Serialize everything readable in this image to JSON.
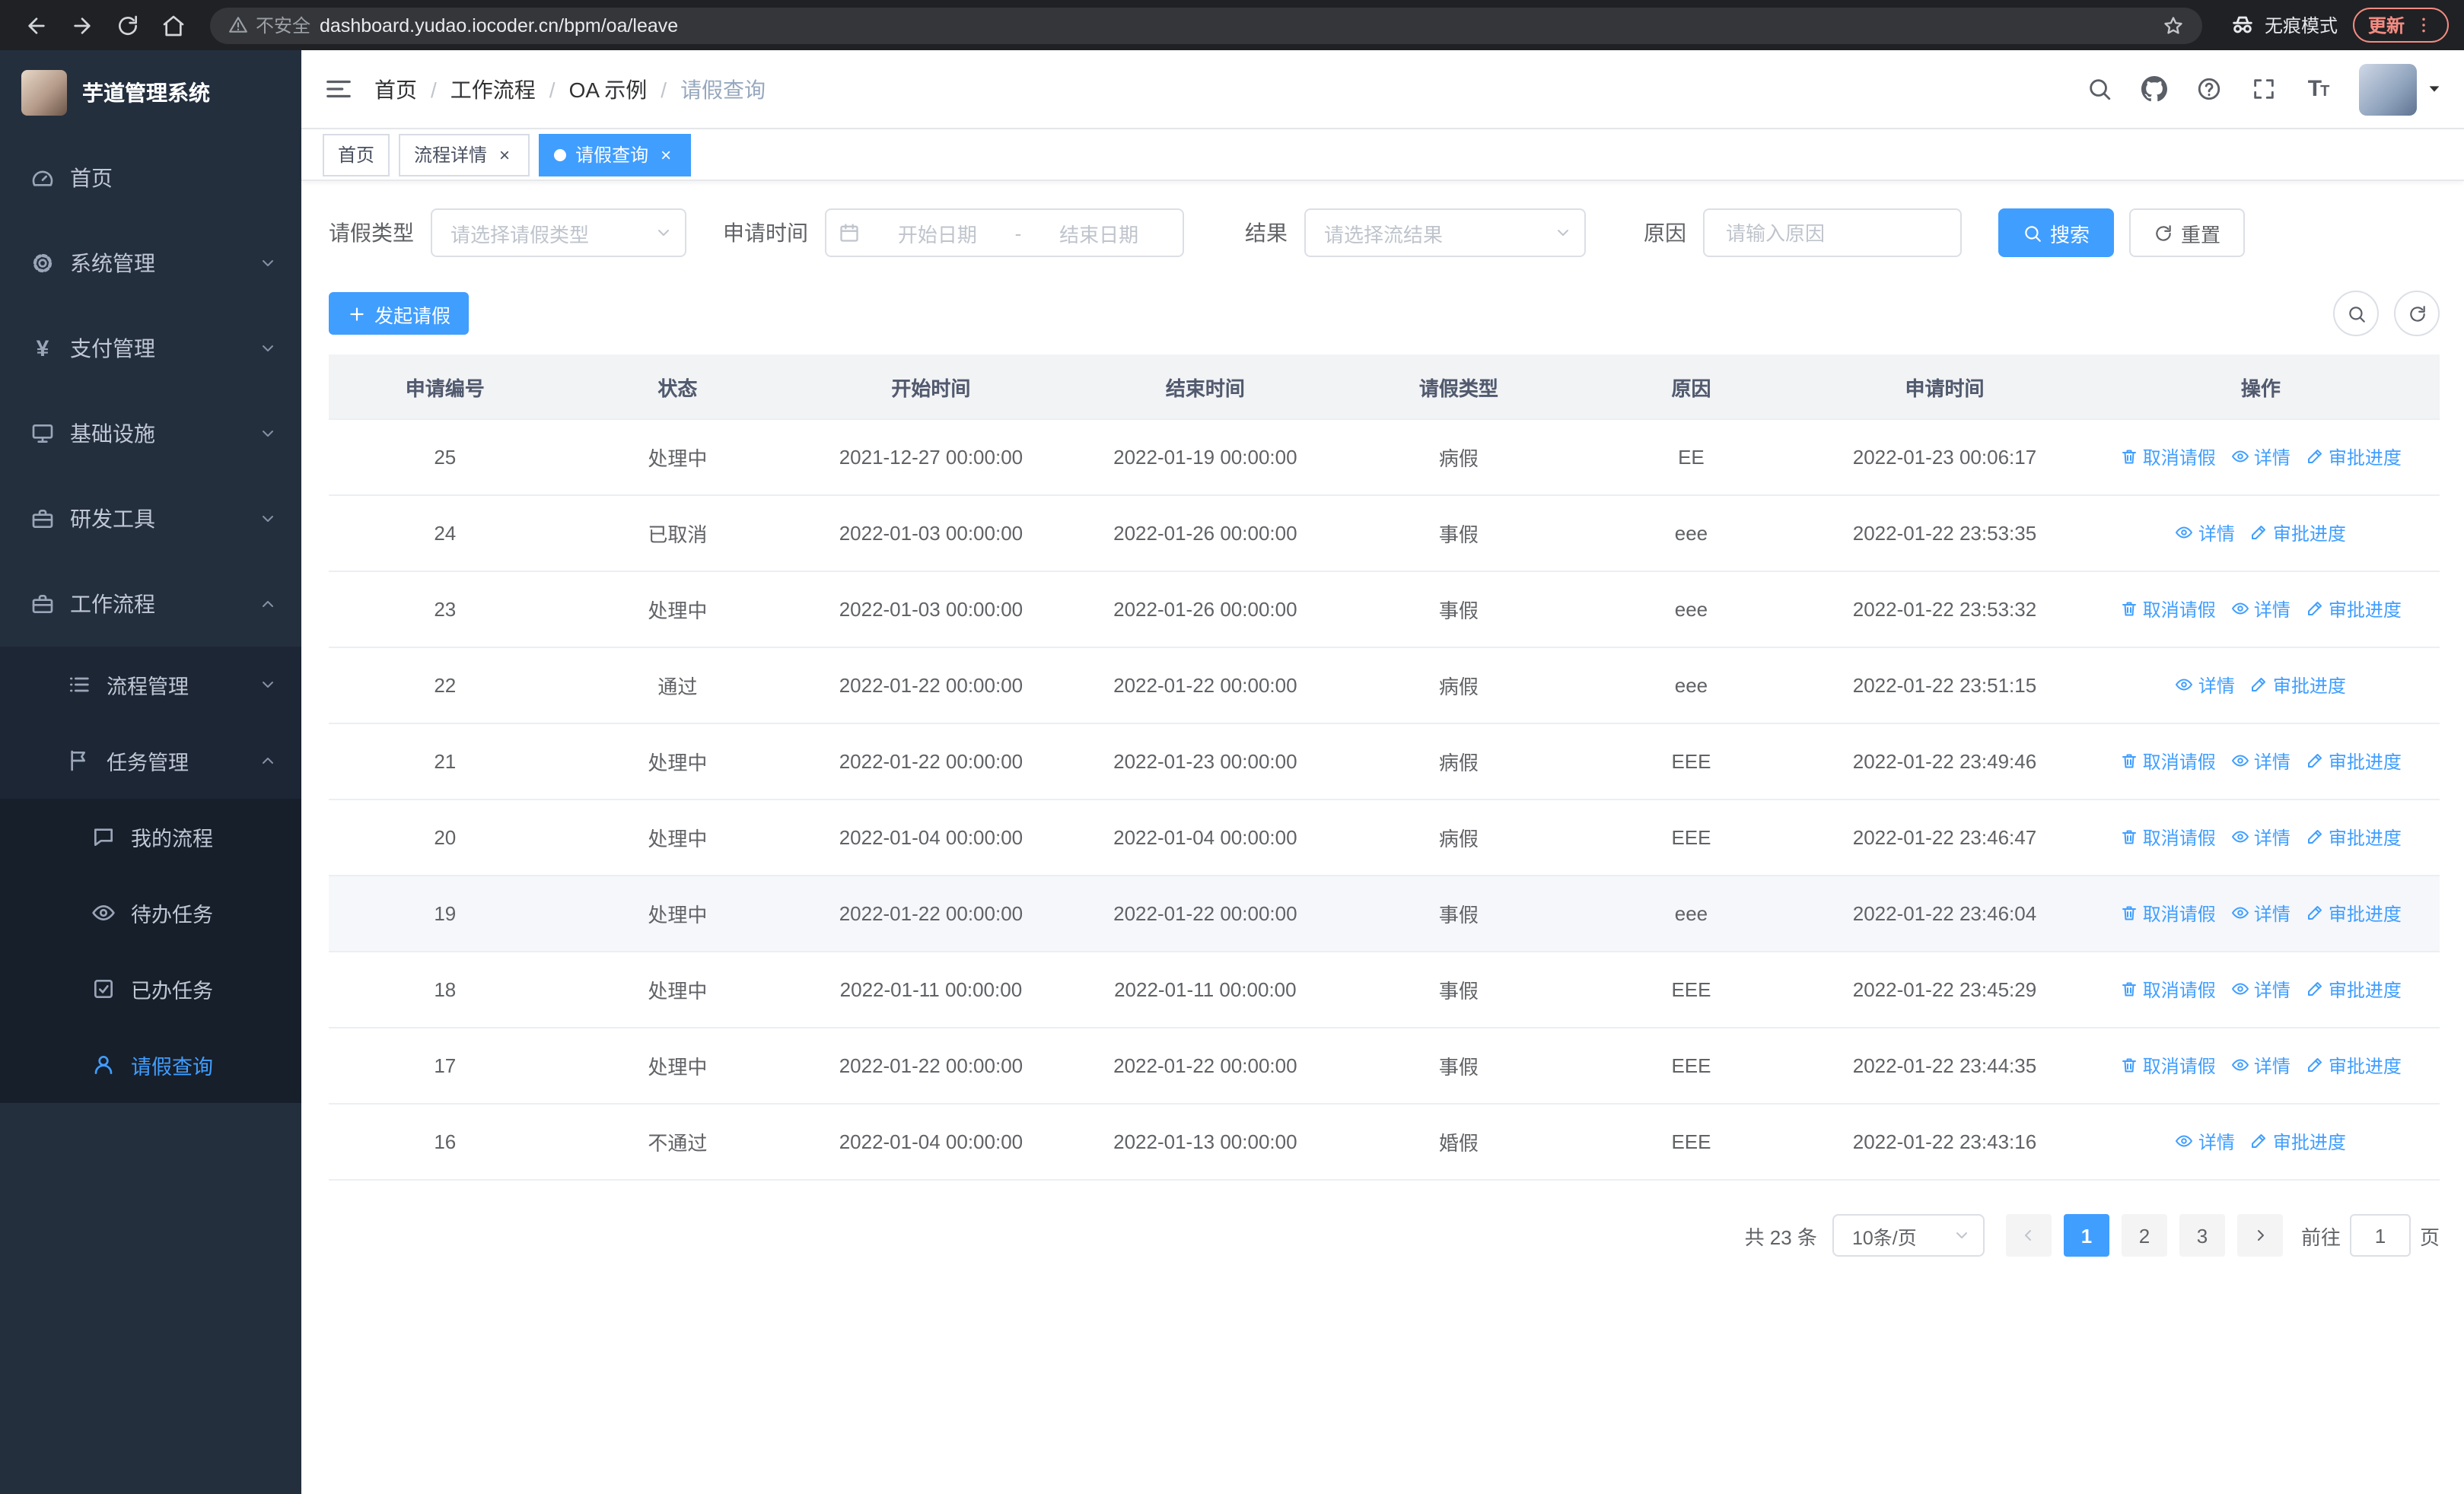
{
  "browser": {
    "security_label": "不安全",
    "url": "dashboard.yudao.iocoder.cn/bpm/oa/leave",
    "incognito_label": "无痕模式",
    "update_label": "更新"
  },
  "sidebar": {
    "logo_title": "芋道管理系统",
    "items": [
      {
        "label": "首页"
      },
      {
        "label": "系统管理"
      },
      {
        "label": "支付管理"
      },
      {
        "label": "基础设施"
      },
      {
        "label": "研发工具"
      },
      {
        "label": "工作流程"
      },
      {
        "label": "流程管理"
      },
      {
        "label": "任务管理"
      },
      {
        "label": "我的流程"
      },
      {
        "label": "待办任务"
      },
      {
        "label": "已办任务"
      },
      {
        "label": "请假查询"
      }
    ]
  },
  "header": {
    "breadcrumb": [
      "首页",
      "工作流程",
      "OA 示例",
      "请假查询"
    ]
  },
  "tabs": [
    {
      "label": "首页"
    },
    {
      "label": "流程详情"
    },
    {
      "label": "请假查询"
    }
  ],
  "filters": {
    "leave_type_label": "请假类型",
    "leave_type_placeholder": "请选择请假类型",
    "apply_time_label": "申请时间",
    "start_date_placeholder": "开始日期",
    "date_separator": "-",
    "end_date_placeholder": "结束日期",
    "result_label": "结果",
    "result_placeholder": "请选择流结果",
    "reason_label": "原因",
    "reason_placeholder": "请输入原因",
    "search_button": "搜索",
    "reset_button": "重置"
  },
  "toolbar": {
    "create_button": "发起请假"
  },
  "table": {
    "columns": [
      "申请编号",
      "状态",
      "开始时间",
      "结束时间",
      "请假类型",
      "原因",
      "申请时间",
      "操作"
    ],
    "col_keys": [
      "id",
      "status",
      "start",
      "end",
      "type",
      "reason",
      "apply"
    ],
    "action_labels": {
      "cancel": "取消请假",
      "detail": "详情",
      "progress": "审批进度"
    },
    "rows": [
      {
        "id": "25",
        "status": "处理中",
        "start": "2021-12-27 00:00:00",
        "end": "2022-01-19 00:00:00",
        "type": "病假",
        "reason": "EE",
        "apply": "2022-01-23 00:06:17",
        "actions": [
          "cancel",
          "detail",
          "progress"
        ],
        "highlight": false
      },
      {
        "id": "24",
        "status": "已取消",
        "start": "2022-01-03 00:00:00",
        "end": "2022-01-26 00:00:00",
        "type": "事假",
        "reason": "eee",
        "apply": "2022-01-22 23:53:35",
        "actions": [
          "detail",
          "progress"
        ],
        "highlight": false
      },
      {
        "id": "23",
        "status": "处理中",
        "start": "2022-01-03 00:00:00",
        "end": "2022-01-26 00:00:00",
        "type": "事假",
        "reason": "eee",
        "apply": "2022-01-22 23:53:32",
        "actions": [
          "cancel",
          "detail",
          "progress"
        ],
        "highlight": false
      },
      {
        "id": "22",
        "status": "通过",
        "start": "2022-01-22 00:00:00",
        "end": "2022-01-22 00:00:00",
        "type": "病假",
        "reason": "eee",
        "apply": "2022-01-22 23:51:15",
        "actions": [
          "detail",
          "progress"
        ],
        "highlight": false
      },
      {
        "id": "21",
        "status": "处理中",
        "start": "2022-01-22 00:00:00",
        "end": "2022-01-23 00:00:00",
        "type": "病假",
        "reason": "EEE",
        "apply": "2022-01-22 23:49:46",
        "actions": [
          "cancel",
          "detail",
          "progress"
        ],
        "highlight": false
      },
      {
        "id": "20",
        "status": "处理中",
        "start": "2022-01-04 00:00:00",
        "end": "2022-01-04 00:00:00",
        "type": "病假",
        "reason": "EEE",
        "apply": "2022-01-22 23:46:47",
        "actions": [
          "cancel",
          "detail",
          "progress"
        ],
        "highlight": false
      },
      {
        "id": "19",
        "status": "处理中",
        "start": "2022-01-22 00:00:00",
        "end": "2022-01-22 00:00:00",
        "type": "事假",
        "reason": "eee",
        "apply": "2022-01-22 23:46:04",
        "actions": [
          "cancel",
          "detail",
          "progress"
        ],
        "highlight": true
      },
      {
        "id": "18",
        "status": "处理中",
        "start": "2022-01-11 00:00:00",
        "end": "2022-01-11 00:00:00",
        "type": "事假",
        "reason": "EEE",
        "apply": "2022-01-22 23:45:29",
        "actions": [
          "cancel",
          "detail",
          "progress"
        ],
        "highlight": false
      },
      {
        "id": "17",
        "status": "处理中",
        "start": "2022-01-22 00:00:00",
        "end": "2022-01-22 00:00:00",
        "type": "事假",
        "reason": "EEE",
        "apply": "2022-01-22 23:44:35",
        "actions": [
          "cancel",
          "detail",
          "progress"
        ],
        "highlight": false
      },
      {
        "id": "16",
        "status": "不通过",
        "start": "2022-01-04 00:00:00",
        "end": "2022-01-13 00:00:00",
        "type": "婚假",
        "reason": "EEE",
        "apply": "2022-01-22 23:43:16",
        "actions": [
          "detail",
          "progress"
        ],
        "highlight": false
      }
    ]
  },
  "pagination": {
    "total_text": "共 23 条",
    "page_size": "10条/页",
    "pages": [
      "1",
      "2",
      "3"
    ],
    "active_page": "1",
    "goto_label": "前往",
    "goto_value": "1",
    "goto_suffix": "页"
  },
  "colors": {
    "accent": "#409eff",
    "sidebar_bg": "#242f3e",
    "update_red": "#f28b82"
  }
}
